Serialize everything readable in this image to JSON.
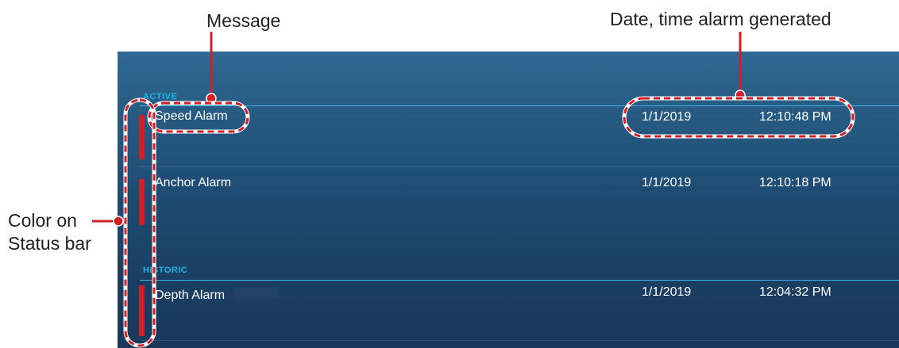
{
  "callouts": {
    "message": "Message",
    "date_time": "Date, time alarm generated",
    "color_line1": "Color on",
    "color_line2": "Status bar"
  },
  "colors": {
    "panel_top": "#2f6a94",
    "panel_bottom": "#18385a",
    "section_header": "#1fb4e8",
    "status_bar_alarm": "#d21f26",
    "callout_red": "#d21f26"
  },
  "alarm_list": {
    "active_header": "ACTIVE",
    "historic_header": "HISTORIC",
    "active": [
      {
        "message": "Speed Alarm",
        "date": "1/1/2019",
        "time": "12:10:48 PM"
      },
      {
        "message": "Anchor Alarm",
        "date": "1/1/2019",
        "time": "12:10:18 PM"
      }
    ],
    "historic": [
      {
        "message": "Depth Alarm",
        "date": "1/1/2019",
        "time": "12:04:32 PM"
      }
    ]
  }
}
